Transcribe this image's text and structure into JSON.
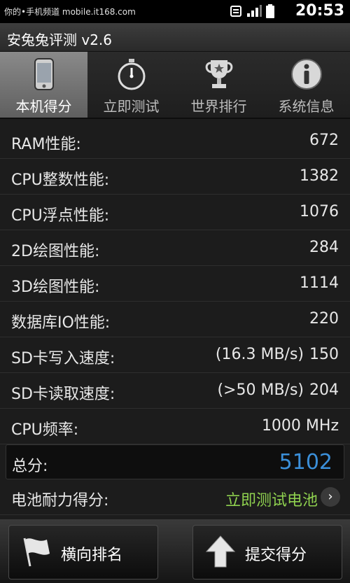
{
  "status": {
    "site": "你的•手机频道 mobile.it168.com",
    "time": "20:53"
  },
  "app": {
    "title": "安兔兔评测 v2.6"
  },
  "tabs": [
    {
      "label": "本机得分",
      "icon": "phone-icon"
    },
    {
      "label": "立即测试",
      "icon": "stopwatch-icon"
    },
    {
      "label": "世界排行",
      "icon": "trophy-icon"
    },
    {
      "label": "系统信息",
      "icon": "info-icon"
    }
  ],
  "results": [
    {
      "label": "RAM性能:",
      "value": "672"
    },
    {
      "label": "CPU整数性能:",
      "value": "1382"
    },
    {
      "label": "CPU浮点性能:",
      "value": "1076"
    },
    {
      "label": "2D绘图性能:",
      "value": "284"
    },
    {
      "label": "3D绘图性能:",
      "value": "1114"
    },
    {
      "label": "数据库IO性能:",
      "value": "220"
    },
    {
      "label": "SD卡写入速度:",
      "speed": "(16.3 MB/s)",
      "value": "150"
    },
    {
      "label": "SD卡读取速度:",
      "speed": "(>50 MB/s)",
      "value": "204"
    },
    {
      "label": "CPU频率:",
      "value": "1000 MHz"
    }
  ],
  "total": {
    "label": "总分:",
    "value": "5102"
  },
  "battery": {
    "label": "电池耐力得分:",
    "link": "立即测试电池",
    "chevron": "›"
  },
  "buttons": {
    "rank": "横向排名",
    "submit": "提交得分"
  },
  "colors": {
    "accent": "#3b8fd9",
    "battery_link": "#8fd14f",
    "active_tab": "#7a7a7a"
  }
}
